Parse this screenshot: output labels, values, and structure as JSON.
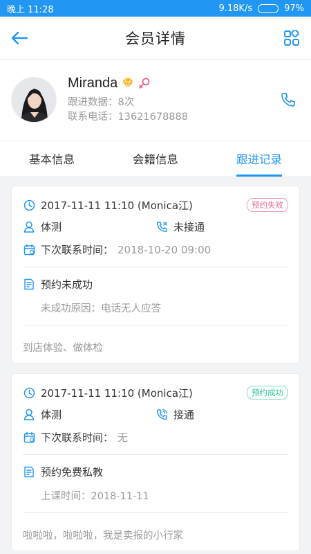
{
  "status": {
    "time": "晚上 11:28",
    "speed": "9.18K/s",
    "battery": "97%",
    "battery_level": 0.97
  },
  "nav": {
    "title": "会员详情"
  },
  "profile": {
    "name": "Miranda",
    "followups": "跟进数据：8次",
    "phone": "联系电话：13621678888"
  },
  "tabs": [
    "基本信息",
    "会籍信息",
    "跟进记录"
  ],
  "records": [
    {
      "datetime": "2017-11-11 11:10 (Monica江)",
      "badge": "预约失败",
      "type": "体测",
      "call_status": "未接通",
      "next_label": "下次联系时间：",
      "next_value": "2018-10-20 09:00",
      "appointment": "预约未成功",
      "detail": "未成功原因：电话无人应答",
      "note": "到店体验、做体检"
    },
    {
      "datetime": "2017-11-11 11:10 (Monica江)",
      "badge": "预约成功",
      "type": "体测",
      "call_status": "接通",
      "next_label": "下次联系时间：",
      "next_value": "无",
      "appointment": "预约免费私教",
      "detail": "上课时间：2018-11-11",
      "note": "啦啦啦，啦啦啦，我是卖报的小行家"
    }
  ],
  "colors": {
    "primary": "#2196f3",
    "fail": "#e2709c",
    "success": "#2cc3a1",
    "gold": "#f3b31d",
    "female": "#ef5f8e"
  }
}
